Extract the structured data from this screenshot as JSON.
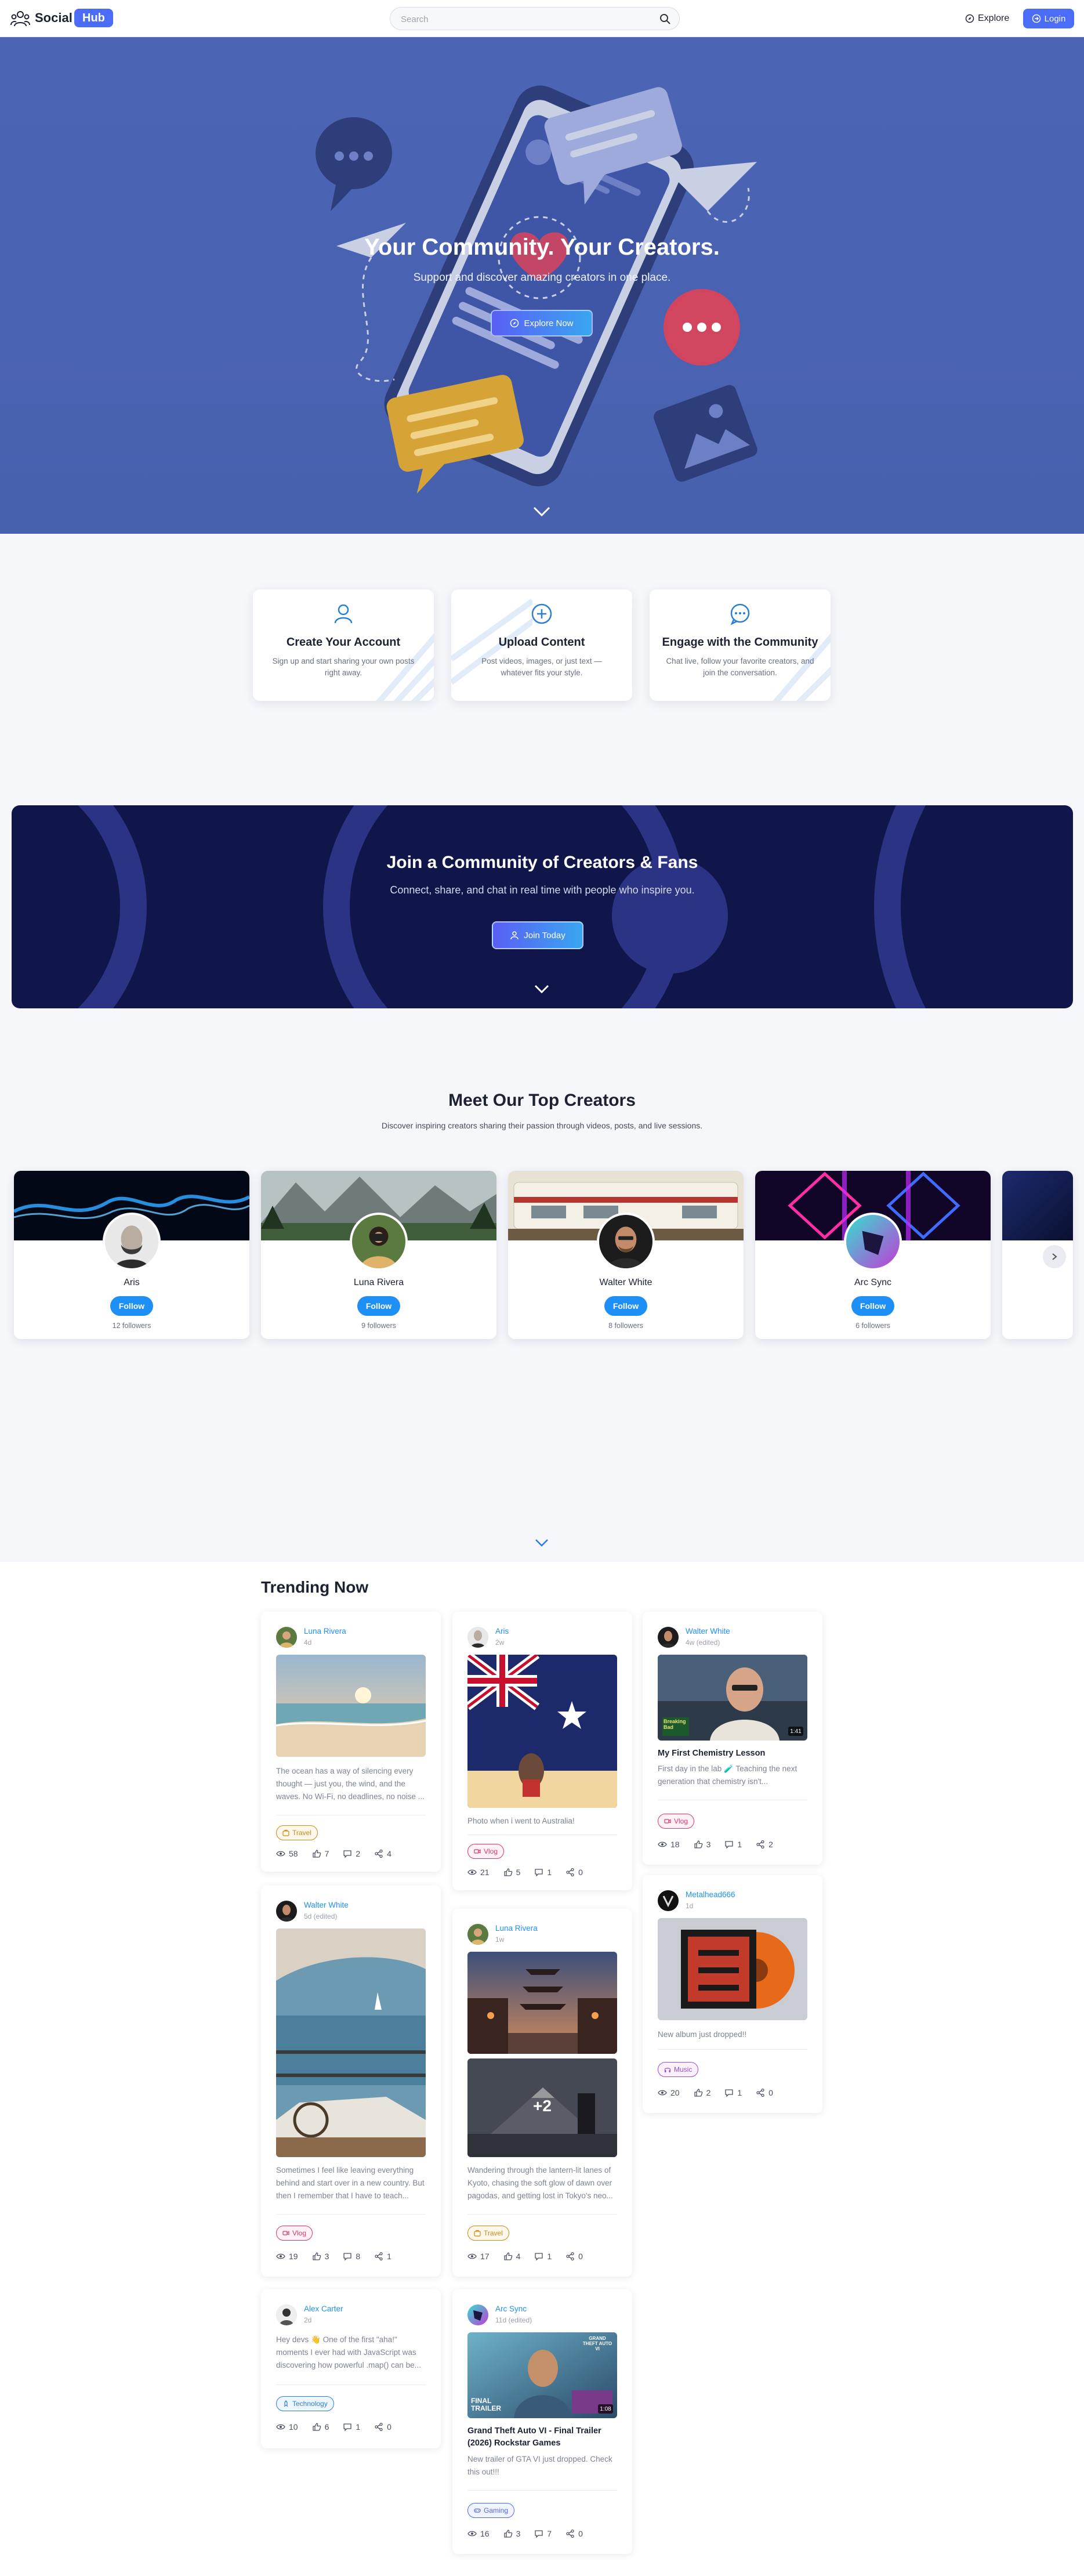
{
  "nav": {
    "logo_text": "Social",
    "logo_badge": "Hub",
    "search_placeholder": "Search",
    "explore_label": "Explore",
    "login_label": "Login"
  },
  "hero": {
    "title": "Your Community. Your Creators.",
    "subtitle": "Support and discover amazing creators in one place.",
    "cta_label": "Explore Now"
  },
  "steps": [
    {
      "title": "Create Your Account",
      "desc": "Sign up and start sharing your own posts right away.",
      "icon": "user-icon"
    },
    {
      "title": "Upload Content",
      "desc": "Post videos, images, or just text — whatever fits your style.",
      "icon": "plus-circle-icon"
    },
    {
      "title": "Engage with the Community",
      "desc": "Chat live, follow your favorite creators, and join the conversation.",
      "icon": "chat-dots-icon"
    }
  ],
  "join": {
    "title": "Join a Community of Creators & Fans",
    "subtitle": "Connect, share, and chat in real time with people who inspire you.",
    "cta_label": "Join Today"
  },
  "creators_section": {
    "title": "Meet Our Top Creators",
    "subtitle": "Discover inspiring creators sharing their passion through videos, posts, and live sessions.",
    "follow_label": "Follow",
    "creators": [
      {
        "name": "Aris",
        "followers": "12 followers"
      },
      {
        "name": "Luna Rivera",
        "followers": "9 followers"
      },
      {
        "name": "Walter White",
        "followers": "8 followers"
      },
      {
        "name": "Arc Sync",
        "followers": "6 followers"
      }
    ]
  },
  "trending": {
    "title": "Trending Now",
    "posts": [
      {
        "author": "Luna Rivera",
        "time": "4d",
        "text": "The ocean has a way of silencing every thought — just you, the wind, and the waves. No Wi-Fi, no deadlines, no noise ...",
        "tag": "Travel",
        "views": "58",
        "likes": "7",
        "comments": "2",
        "shares": "4"
      },
      {
        "author": "Aris",
        "time": "2w",
        "text": "Photo when i went to Australia!",
        "tag": "Vlog",
        "views": "21",
        "likes": "5",
        "comments": "1",
        "shares": "0"
      },
      {
        "author": "Walter White",
        "time": "4w (edited)",
        "title": "My First Chemistry Lesson",
        "text": "First day in the lab 🧪 Teaching the next generation that chemistry isn't...",
        "tag": "Vlog",
        "views": "18",
        "likes": "3",
        "comments": "1",
        "shares": "2",
        "video_duration": "1:41",
        "overlay": "Breaking Bad"
      },
      {
        "author": "Walter White",
        "time": "5d (edited)",
        "text": "Sometimes I feel like leaving everything behind and start over in a new country. But then I remember that I have to teach...",
        "tag": "Vlog",
        "views": "19",
        "likes": "3",
        "comments": "8",
        "shares": "1"
      },
      {
        "author": "Luna Rivera",
        "time": "1w",
        "text": "Wandering through the lantern-lit lanes of Kyoto, chasing the soft glow of dawn over pagodas, and getting lost in Tokyo's neo...",
        "tag": "Travel",
        "views": "17",
        "likes": "4",
        "comments": "1",
        "shares": "0",
        "more_images": "+2"
      },
      {
        "author": "Metalhead666",
        "time": "1d",
        "text": "New album just dropped!!",
        "tag": "Music",
        "views": "20",
        "likes": "2",
        "comments": "1",
        "shares": "0"
      },
      {
        "author": "Alex Carter",
        "time": "2d",
        "text": "Hey devs 👋 One of the first \"aha!\" moments I ever had with JavaScript was discovering how powerful .map() can be...",
        "tag": "Technology",
        "views": "10",
        "likes": "6",
        "comments": "1",
        "shares": "0"
      },
      {
        "author": "Arc Sync",
        "time": "11d (edited)",
        "title": "Grand Theft Auto VI - Final Trailer (2026) Rockstar Games",
        "text": "New trailer of GTA VI just dropped. Check this out!!!",
        "tag": "Gaming",
        "views": "16",
        "likes": "3",
        "comments": "7",
        "shares": "0",
        "video_duration": "1:08",
        "overlay": "FINAL TRAILER",
        "badge": "GRAND THEFT AUTO VI"
      }
    ]
  },
  "colors": {
    "brand": "#4a6cf7",
    "hero_bg": "#4c64b4",
    "join_bg": "#10154a",
    "follow": "#1e8ff5"
  }
}
